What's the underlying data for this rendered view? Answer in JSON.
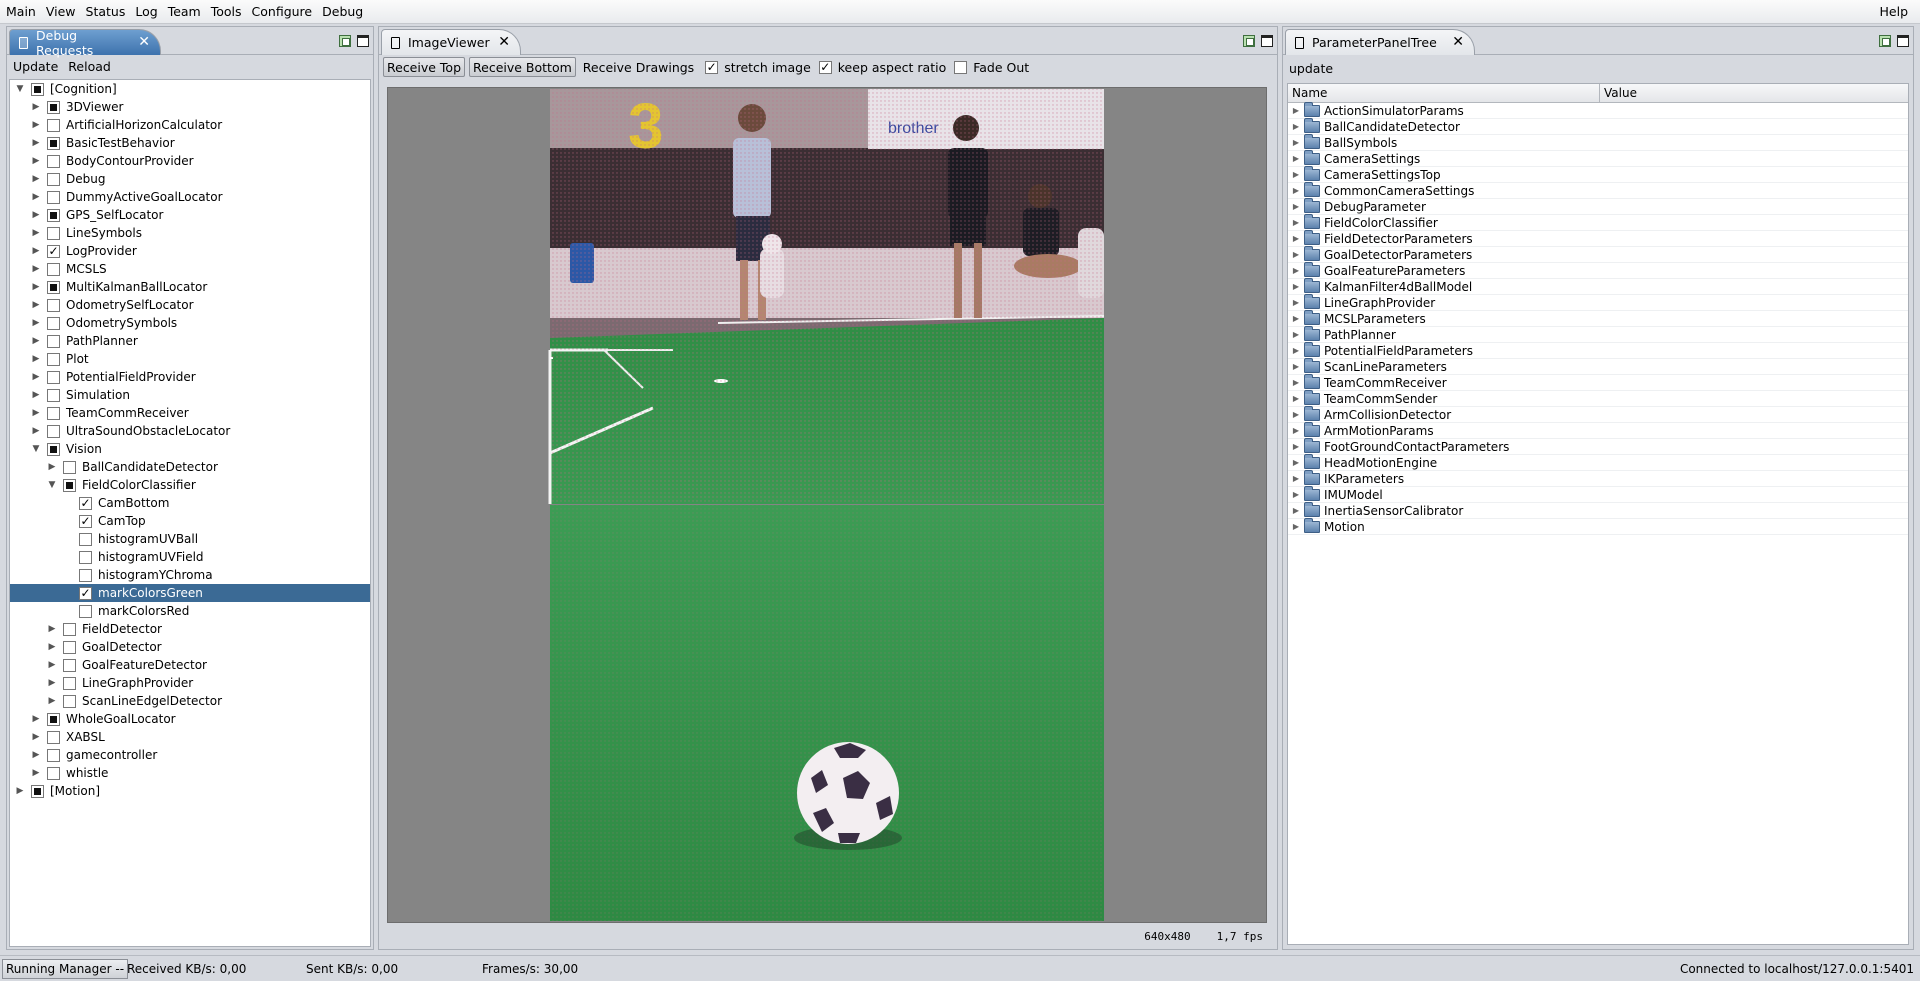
{
  "menu": {
    "items": [
      "Main",
      "View",
      "Status",
      "Log",
      "Team",
      "Tools",
      "Configure",
      "Debug"
    ],
    "help": "Help"
  },
  "left_panel": {
    "tab_title": "Debug Requests",
    "toolbar": {
      "update": "Update",
      "reload": "Reload"
    },
    "tree": [
      {
        "label": "[Cognition]",
        "depth": 0,
        "expanded": true,
        "state": "partial"
      },
      {
        "label": "3DViewer",
        "depth": 1,
        "expanded": false,
        "state": "partial"
      },
      {
        "label": "ArtificialHorizonCalculator",
        "depth": 1,
        "expanded": false,
        "state": "empty"
      },
      {
        "label": "BasicTestBehavior",
        "depth": 1,
        "expanded": false,
        "state": "partial"
      },
      {
        "label": "BodyContourProvider",
        "depth": 1,
        "expanded": false,
        "state": "empty"
      },
      {
        "label": "Debug",
        "depth": 1,
        "expanded": false,
        "state": "empty"
      },
      {
        "label": "DummyActiveGoalLocator",
        "depth": 1,
        "expanded": false,
        "state": "empty"
      },
      {
        "label": "GPS_SelfLocator",
        "depth": 1,
        "expanded": false,
        "state": "partial"
      },
      {
        "label": "LineSymbols",
        "depth": 1,
        "expanded": false,
        "state": "empty"
      },
      {
        "label": "LogProvider",
        "depth": 1,
        "expanded": false,
        "state": "checked"
      },
      {
        "label": "MCSLS",
        "depth": 1,
        "expanded": false,
        "state": "empty"
      },
      {
        "label": "MultiKalmanBallLocator",
        "depth": 1,
        "expanded": false,
        "state": "partial"
      },
      {
        "label": "OdometrySelfLocator",
        "depth": 1,
        "expanded": false,
        "state": "empty"
      },
      {
        "label": "OdometrySymbols",
        "depth": 1,
        "expanded": false,
        "state": "empty"
      },
      {
        "label": "PathPlanner",
        "depth": 1,
        "expanded": false,
        "state": "empty"
      },
      {
        "label": "Plot",
        "depth": 1,
        "expanded": false,
        "state": "empty"
      },
      {
        "label": "PotentialFieldProvider",
        "depth": 1,
        "expanded": false,
        "state": "empty"
      },
      {
        "label": "Simulation",
        "depth": 1,
        "expanded": false,
        "state": "empty"
      },
      {
        "label": "TeamCommReceiver",
        "depth": 1,
        "expanded": false,
        "state": "empty"
      },
      {
        "label": "UltraSoundObstacleLocator",
        "depth": 1,
        "expanded": false,
        "state": "empty"
      },
      {
        "label": "Vision",
        "depth": 1,
        "expanded": true,
        "state": "partial"
      },
      {
        "label": "BallCandidateDetector",
        "depth": 2,
        "expanded": false,
        "state": "empty"
      },
      {
        "label": "FieldColorClassifier",
        "depth": 2,
        "expanded": true,
        "state": "partial"
      },
      {
        "label": "CamBottom",
        "depth": 3,
        "leaf": true,
        "state": "checked"
      },
      {
        "label": "CamTop",
        "depth": 3,
        "leaf": true,
        "state": "checked"
      },
      {
        "label": "histogramUVBall",
        "depth": 3,
        "leaf": true,
        "state": "empty"
      },
      {
        "label": "histogramUVField",
        "depth": 3,
        "leaf": true,
        "state": "empty"
      },
      {
        "label": "histogramYChroma",
        "depth": 3,
        "leaf": true,
        "state": "empty"
      },
      {
        "label": "markColorsGreen",
        "depth": 3,
        "leaf": true,
        "state": "checked",
        "selected": true
      },
      {
        "label": "markColorsRed",
        "depth": 3,
        "leaf": true,
        "state": "empty"
      },
      {
        "label": "FieldDetector",
        "depth": 2,
        "expanded": false,
        "state": "empty"
      },
      {
        "label": "GoalDetector",
        "depth": 2,
        "expanded": false,
        "state": "empty"
      },
      {
        "label": "GoalFeatureDetector",
        "depth": 2,
        "expanded": false,
        "state": "empty"
      },
      {
        "label": "LineGraphProvider",
        "depth": 2,
        "expanded": false,
        "state": "empty"
      },
      {
        "label": "ScanLineEdgelDetector",
        "depth": 2,
        "expanded": false,
        "state": "empty"
      },
      {
        "label": "WholeGoalLocator",
        "depth": 1,
        "expanded": false,
        "state": "partial"
      },
      {
        "label": "XABSL",
        "depth": 1,
        "expanded": false,
        "state": "empty"
      },
      {
        "label": "gamecontroller",
        "depth": 1,
        "expanded": false,
        "state": "empty"
      },
      {
        "label": "whistle",
        "depth": 1,
        "expanded": false,
        "state": "empty"
      },
      {
        "label": "[Motion]",
        "depth": 0,
        "expanded": false,
        "state": "partial"
      }
    ]
  },
  "image_viewer": {
    "tab_title": "ImageViewer",
    "toolbar": {
      "receive_top": "Receive Top",
      "receive_bottom": "Receive Bottom",
      "receive_drawings": "Receive Drawings",
      "stretch_image": "stretch image",
      "keep_aspect_ratio": "keep aspect ratio",
      "fade_out": "Fade Out"
    },
    "checks": {
      "stretch_image": true,
      "keep_aspect_ratio": true,
      "fade_out": false
    },
    "resolution": "640x480",
    "fps": "1,7 fps",
    "top_image_text": "3",
    "banner_text": "brother",
    "colors": {
      "field": "#2f8d45",
      "viewer_bg": "#858585"
    }
  },
  "parameter_panel": {
    "tab_title": "ParameterPanelTree",
    "update": "update",
    "columns": {
      "name": "Name",
      "value": "Value"
    },
    "items": [
      "ActionSimulatorParams",
      "BallCandidateDetector",
      "BallSymbols",
      "CameraSettings",
      "CameraSettingsTop",
      "CommonCameraSettings",
      "DebugParameter",
      "FieldColorClassifier",
      "FieldDetectorParameters",
      "GoalDetectorParameters",
      "GoalFeatureParameters",
      "KalmanFilter4dBallModel",
      "LineGraphProvider",
      "MCSLParameters",
      "PathPlanner",
      "PotentialFieldParameters",
      "ScanLineParameters",
      "TeamCommReceiver",
      "TeamCommSender",
      "ArmCollisionDetector",
      "ArmMotionParams",
      "FootGroundContactParameters",
      "HeadMotionEngine",
      "IKParameters",
      "IMUModel",
      "InertiaSensorCalibrator",
      "Motion"
    ]
  },
  "statusbar": {
    "manager_button": "Running Manager --",
    "received": "Received KB/s: 0,00",
    "sent": "Sent KB/s: 0,00",
    "frames": "Frames/s: 30,00",
    "connection": "Connected to localhost/127.0.0.1:5401"
  }
}
